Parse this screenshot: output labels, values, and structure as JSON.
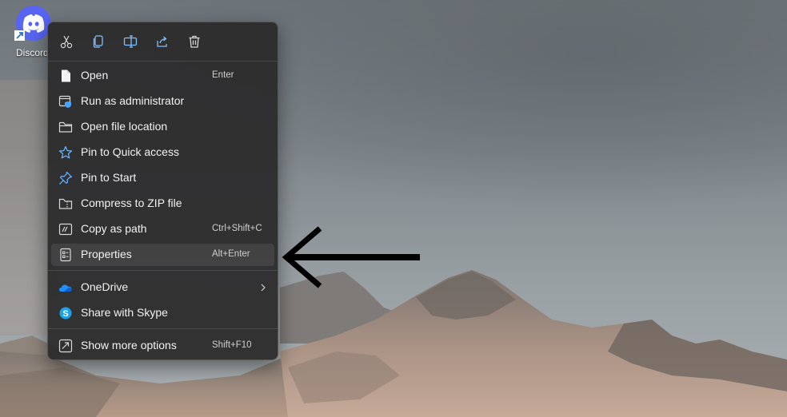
{
  "desktop": {
    "icon_label": "Discord"
  },
  "context_menu": {
    "quick_actions": [
      {
        "name": "cut",
        "icon": "scissors-icon"
      },
      {
        "name": "copy",
        "icon": "copy-icon"
      },
      {
        "name": "rename",
        "icon": "rename-icon"
      },
      {
        "name": "share",
        "icon": "share-icon"
      },
      {
        "name": "delete",
        "icon": "trash-icon"
      }
    ],
    "items": [
      {
        "label": "Open",
        "shortcut": "Enter",
        "icon": "file-icon"
      },
      {
        "label": "Run as administrator",
        "shortcut": "",
        "icon": "shield-window-icon"
      },
      {
        "label": "Open file location",
        "shortcut": "",
        "icon": "folder-icon"
      },
      {
        "label": "Pin to Quick access",
        "shortcut": "",
        "icon": "star-icon"
      },
      {
        "label": "Pin to Start",
        "shortcut": "",
        "icon": "pin-icon"
      },
      {
        "label": "Compress to ZIP file",
        "shortcut": "",
        "icon": "zip-folder-icon"
      },
      {
        "label": "Copy as path",
        "shortcut": "Ctrl+Shift+C",
        "icon": "path-icon"
      },
      {
        "label": "Properties",
        "shortcut": "Alt+Enter",
        "icon": "properties-icon",
        "highlighted": true
      }
    ],
    "items2": [
      {
        "label": "OneDrive",
        "icon": "onedrive-cloud-icon",
        "has_submenu": true
      },
      {
        "label": "Share with Skype",
        "icon": "skype-icon"
      }
    ],
    "items3": [
      {
        "label": "Show more options",
        "shortcut": "Shift+F10",
        "icon": "more-options-icon"
      }
    ]
  },
  "colors": {
    "menu_bg": "#2c2a2c",
    "accent_blue": "#60b5ff",
    "discord_blurple": "#5865f2"
  }
}
